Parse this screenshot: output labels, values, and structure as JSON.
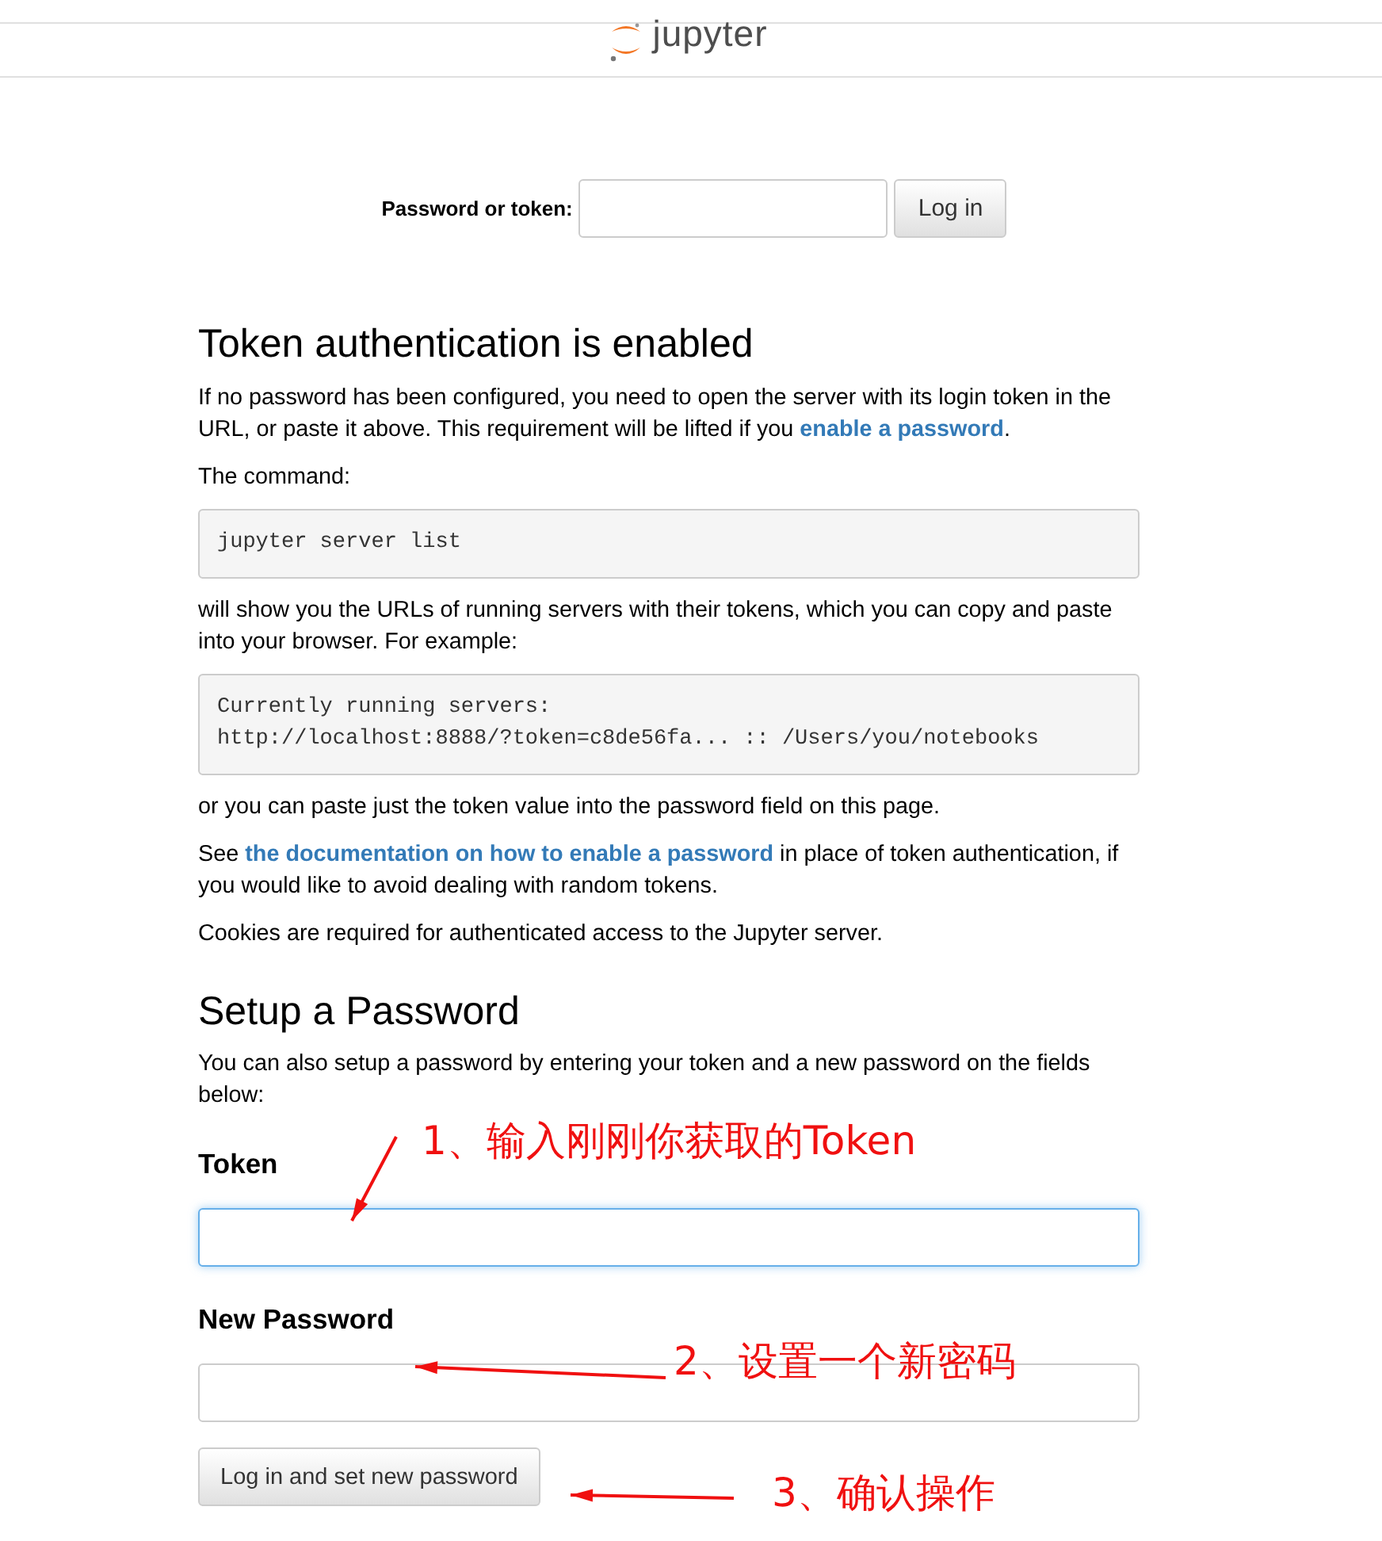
{
  "header": {
    "logo_text": "jupyter"
  },
  "login": {
    "label": "Password or token:",
    "button": "Log in"
  },
  "token_section": {
    "heading": "Token authentication is enabled",
    "blocks": [
      {
        "kind": "paragraph",
        "parts": [
          {
            "text": "If no password has been configured, you need to open the server with its login token in the URL, or paste it above. This requirement will be lifted if you ",
            "link": false
          },
          {
            "text": "enable a password",
            "link": true
          },
          {
            "text": ".",
            "link": false
          }
        ]
      },
      {
        "kind": "paragraph",
        "parts": [
          {
            "text": "The command:",
            "link": false
          }
        ]
      },
      {
        "kind": "code",
        "lines": [
          "jupyter server list"
        ]
      },
      {
        "kind": "paragraph",
        "parts": [
          {
            "text": "will show you the URLs of running servers with their tokens, which you can copy and paste into your browser. For example:",
            "link": false
          }
        ]
      },
      {
        "kind": "code",
        "lines": [
          "Currently running servers:",
          "http://localhost:8888/?token=c8de56fa... :: /Users/you/notebooks"
        ]
      },
      {
        "kind": "paragraph",
        "parts": [
          {
            "text": "or you can paste just the token value into the password field on this page.",
            "link": false
          }
        ]
      },
      {
        "kind": "paragraph",
        "parts": [
          {
            "text": "See ",
            "link": false
          },
          {
            "text": "the documentation on how to enable a password",
            "link": true
          },
          {
            "text": " in place of token authentication, if you would like to avoid dealing with random tokens.",
            "link": false
          }
        ]
      },
      {
        "kind": "paragraph",
        "parts": [
          {
            "text": "Cookies are required for authenticated access to the Jupyter server.",
            "link": false
          }
        ]
      }
    ]
  },
  "password_section": {
    "heading": "Setup a Password",
    "intro": "You can also setup a password by entering your token and a new password on the fields below:",
    "fields": [
      {
        "label": "Token",
        "focused": true
      },
      {
        "label": "New Password",
        "focused": false
      }
    ],
    "button": "Log in and set new password"
  },
  "annotations": [
    {
      "text": "1、输入刚刚你获取的Token"
    },
    {
      "text": "2、设置一个新密码"
    },
    {
      "text": "3、确认操作"
    }
  ]
}
